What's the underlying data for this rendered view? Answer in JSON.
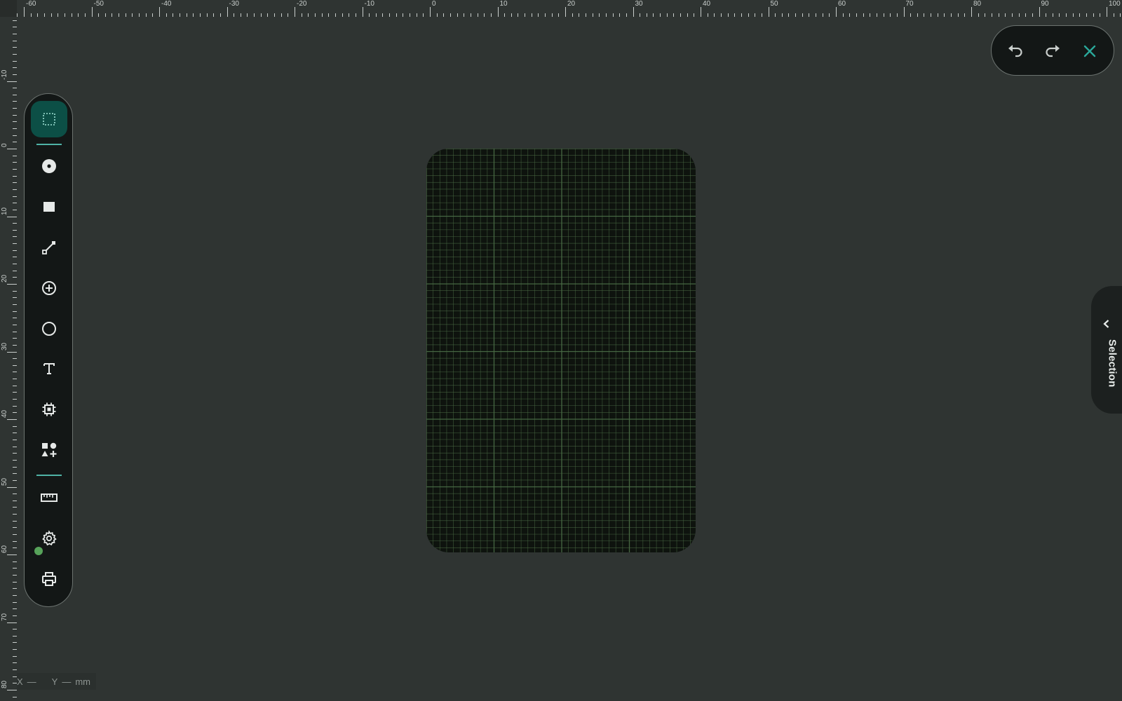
{
  "ruler": {
    "unit": "mm",
    "top_labels": [
      "-60",
      "-50",
      "-40",
      "-30",
      "-20",
      "-10",
      "0",
      "10",
      "20",
      "30",
      "40",
      "50",
      "60",
      "70",
      "80",
      "90",
      "100"
    ],
    "left_labels": [
      "-10",
      "0",
      "10",
      "20",
      "30",
      "40",
      "50",
      "60",
      "70",
      "80"
    ]
  },
  "toolbar": {
    "tools": [
      {
        "name": "select-tool",
        "icon": "dotted-rect-icon",
        "active": true
      },
      {
        "name": "pad-tool",
        "icon": "filled-circle-dot-icon",
        "active": false
      },
      {
        "name": "rect-tool",
        "icon": "filled-square-icon",
        "active": false
      },
      {
        "name": "trace-tool",
        "icon": "line-segment-icon",
        "active": false
      },
      {
        "name": "via-tool",
        "icon": "circle-plus-icon",
        "active": false
      },
      {
        "name": "circle-tool",
        "icon": "circle-outline-icon",
        "active": false
      },
      {
        "name": "text-tool",
        "icon": "text-t-icon",
        "active": false
      },
      {
        "name": "component-tool",
        "icon": "chip-icon",
        "active": false
      },
      {
        "name": "shapes-tool",
        "icon": "shapes-add-icon",
        "active": false
      },
      {
        "name": "measure-tool",
        "icon": "ruler-icon",
        "active": false
      },
      {
        "name": "settings-tool",
        "icon": "gear-icon",
        "active": false
      },
      {
        "name": "print-tool",
        "icon": "printer-icon",
        "active": false
      }
    ],
    "status_color": "#57a35a"
  },
  "history": {
    "undo_icon": "undo-icon",
    "redo_icon": "redo-icon",
    "close_icon": "close-icon"
  },
  "selection_panel": {
    "label": "Selection"
  },
  "coords": {
    "x_label": "X",
    "x_value": "—",
    "y_label": "Y",
    "y_value": "—",
    "unit": "mm"
  },
  "colors": {
    "background": "#2f3432",
    "accent": "#0c4f46",
    "accent_line": "#4fb3a6",
    "close_icon": "#2aa89a",
    "board": "#0e130e",
    "grid": "#4a6b45"
  }
}
